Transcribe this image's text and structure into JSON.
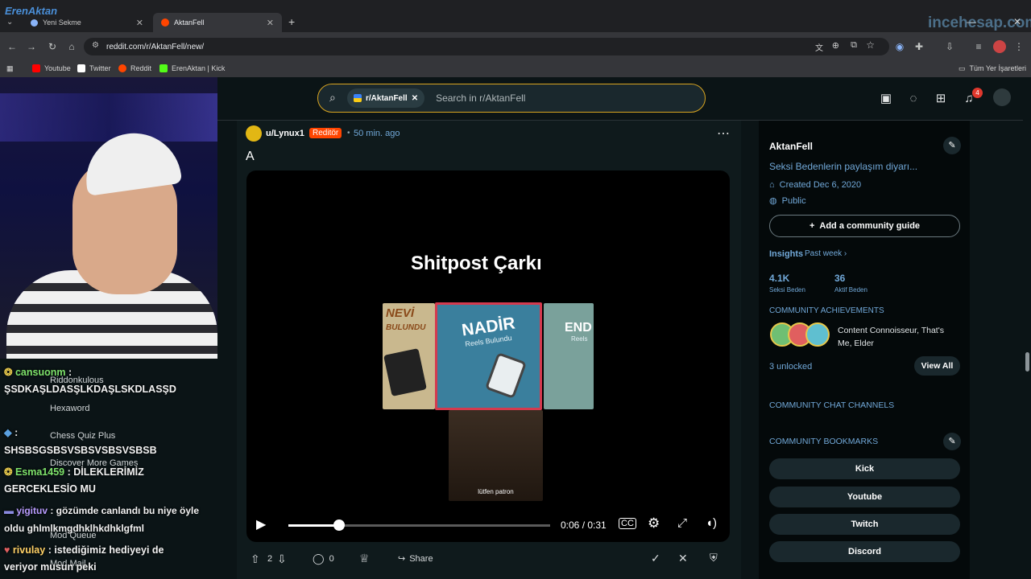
{
  "browser": {
    "tabs": [
      {
        "title": "Yeni Sekme"
      },
      {
        "title": "AktanFell"
      }
    ],
    "url": "reddit.com/r/AktanFell/new/",
    "bookmarks": [
      "Youtube",
      "Twitter",
      "Reddit",
      "ErenAktan | Kick"
    ],
    "bookmarks_right": "Tüm Yer İşaretleri",
    "watermark_left": "ErenAktan",
    "watermark_right": "incehesap.com"
  },
  "reddit_header": {
    "search_chip": "r/AktanFell",
    "search_placeholder": "Search in r/AktanFell",
    "notification_count": "4"
  },
  "post": {
    "author": "u/Lynux1",
    "flair": "Reditör",
    "time": "50 min. ago",
    "title": "A",
    "video_title": "Shitpost Çarkı",
    "cards": [
      "NEVİ",
      "BULUNDU",
      "NADİR",
      "Reels Bulundu",
      "END",
      "Reels"
    ],
    "clip_caption": "lütfen patron",
    "time_current": "0:06",
    "time_total": "0:31",
    "progress": 0.194,
    "votes": "2",
    "comments": "0",
    "share_label": "Share"
  },
  "sidebar": {
    "name": "AktanFell",
    "description": "Seksi Bedenlerin paylaşım diyarı...",
    "created": "Created Dec 6, 2020",
    "visibility": "Public",
    "guide_button": "Add a community guide",
    "insights_label": "Insights",
    "insights_range": "Past week",
    "members_value": "4.1K",
    "members_label": "Seksi Beden",
    "online_value": "36",
    "online_label": "Aktif Beden",
    "achievements_title": "COMMUNITY ACHIEVEMENTS",
    "achievements_text": "Content Connoisseur, That's Me, Elder",
    "unlocked": "3 unlocked",
    "view_all": "View All",
    "chat_channels": "COMMUNITY CHAT CHANNELS",
    "bookmarks_title": "COMMUNITY BOOKMARKS",
    "bookmark_links": [
      "Kick",
      "Youtube",
      "Twitch",
      "Discord"
    ]
  },
  "chat": {
    "lines": [
      {
        "user": "cansuonm",
        "text": " :"
      },
      {
        "user": "",
        "text": "ŞSDKAŞLDASŞLKDAŞLSKDLASŞD"
      },
      {
        "user": "",
        "text": " :"
      },
      {
        "user": "",
        "text": "SHSBSGSBSVSBSVSBSVSBSB"
      },
      {
        "user": "Esma1459",
        "text": " : DİLEKLERİMİZ"
      },
      {
        "user": "",
        "text": "GERCEKLESİO MU"
      },
      {
        "user": "yigituv",
        "text": " : gözümde canlandı bu niye öyle"
      },
      {
        "user": "",
        "text": "oldu ghlmlkmgdhklhkdhklgfml"
      },
      {
        "user": "rivulay",
        "text": " : istediğimiz hediyeyi de"
      },
      {
        "user": "",
        "text": "veriyor musun peki"
      }
    ],
    "ghost_nav": [
      "Riddonkulous",
      "Hexaword",
      "Chess Quiz Plus",
      "Discover More Games",
      "Mod Queue",
      "Mod Mail"
    ]
  }
}
